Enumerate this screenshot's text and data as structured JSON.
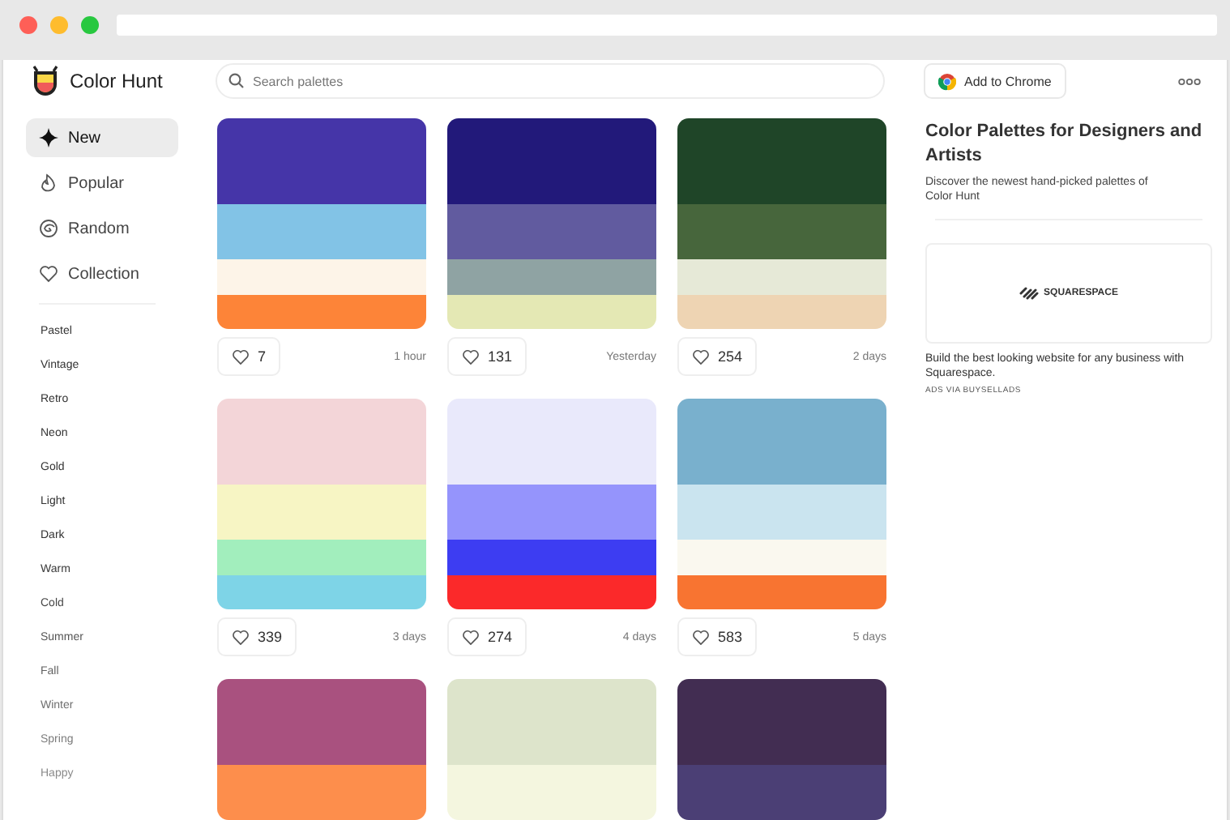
{
  "brand": {
    "name": "Color Hunt"
  },
  "search": {
    "placeholder": "Search palettes"
  },
  "header": {
    "chrome_button": "Add to Chrome"
  },
  "nav": [
    {
      "label": "New",
      "selected": true
    },
    {
      "label": "Popular",
      "selected": false
    },
    {
      "label": "Random",
      "selected": false
    },
    {
      "label": "Collection",
      "selected": false
    }
  ],
  "categories": [
    "Pastel",
    "Vintage",
    "Retro",
    "Neon",
    "Gold",
    "Light",
    "Dark",
    "Warm",
    "Cold",
    "Summer",
    "Fall",
    "Winter",
    "Spring",
    "Happy"
  ],
  "palettes": [
    {
      "stripes": [
        {
          "color": "#4535a8"
        },
        {
          "color": "#82c3e6"
        },
        {
          "color": "#fdf4e8"
        },
        {
          "color": "#fd8438"
        }
      ],
      "likes": "7",
      "time": "1 hour"
    },
    {
      "stripes": [
        {
          "color": "#22197a"
        },
        {
          "color": "#615b9f"
        },
        {
          "color": "#8fa3a3"
        },
        {
          "color": "#e4e8b4"
        }
      ],
      "likes": "131",
      "time": "Yesterday"
    },
    {
      "stripes": [
        {
          "color": "#1f4528"
        },
        {
          "color": "#47663c"
        },
        {
          "color": "#e6e9d7"
        },
        {
          "color": "#eed4b3"
        }
      ],
      "likes": "254",
      "time": "2 days"
    },
    {
      "stripes": [
        {
          "color": "#f3d5d8"
        },
        {
          "color": "#f7f5c4"
        },
        {
          "color": "#a2eebd"
        },
        {
          "color": "#7ed4e7"
        }
      ],
      "likes": "339",
      "time": "3 days"
    },
    {
      "stripes": [
        {
          "color": "#e9e9fb"
        },
        {
          "color": "#9594fc"
        },
        {
          "color": "#3d3df2"
        },
        {
          "color": "#fb292a"
        }
      ],
      "likes": "274",
      "time": "4 days"
    },
    {
      "stripes": [
        {
          "color": "#79b0cd"
        },
        {
          "color": "#cae4ef"
        },
        {
          "color": "#faf8ef"
        },
        {
          "color": "#f87431"
        }
      ],
      "likes": "583",
      "time": "5 days"
    },
    {
      "stripes": [
        {
          "color": "#a9517f"
        },
        {
          "color": "#fd8e4c"
        }
      ]
    },
    {
      "stripes": [
        {
          "color": "#dde4cb"
        },
        {
          "color": "#f4f6df"
        }
      ]
    },
    {
      "stripes": [
        {
          "color": "#422d52"
        },
        {
          "color": "#4b3f75"
        }
      ]
    }
  ],
  "aside": {
    "title": "Color Palettes for Designers and Artists",
    "description": "Discover the newest hand-picked palettes of Color Hunt",
    "ad": {
      "brand": "SQUARESPACE",
      "text": "Build the best looking website for any business with Squarespace.",
      "note": "ADS VIA BUYSELLADS"
    }
  }
}
